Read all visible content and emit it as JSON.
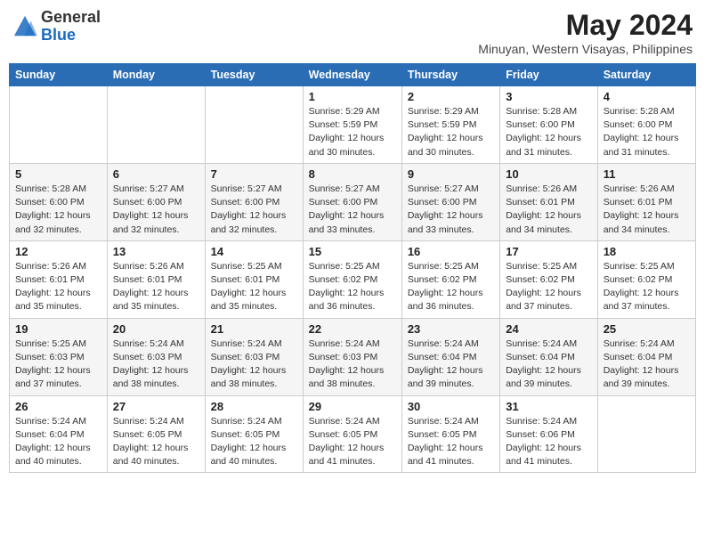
{
  "header": {
    "logo_general": "General",
    "logo_blue": "Blue",
    "month_year": "May 2024",
    "location": "Minuyan, Western Visayas, Philippines"
  },
  "days_of_week": [
    "Sunday",
    "Monday",
    "Tuesday",
    "Wednesday",
    "Thursday",
    "Friday",
    "Saturday"
  ],
  "weeks": [
    [
      {
        "num": "",
        "info": ""
      },
      {
        "num": "",
        "info": ""
      },
      {
        "num": "",
        "info": ""
      },
      {
        "num": "1",
        "info": "Sunrise: 5:29 AM\nSunset: 5:59 PM\nDaylight: 12 hours\nand 30 minutes."
      },
      {
        "num": "2",
        "info": "Sunrise: 5:29 AM\nSunset: 5:59 PM\nDaylight: 12 hours\nand 30 minutes."
      },
      {
        "num": "3",
        "info": "Sunrise: 5:28 AM\nSunset: 6:00 PM\nDaylight: 12 hours\nand 31 minutes."
      },
      {
        "num": "4",
        "info": "Sunrise: 5:28 AM\nSunset: 6:00 PM\nDaylight: 12 hours\nand 31 minutes."
      }
    ],
    [
      {
        "num": "5",
        "info": "Sunrise: 5:28 AM\nSunset: 6:00 PM\nDaylight: 12 hours\nand 32 minutes."
      },
      {
        "num": "6",
        "info": "Sunrise: 5:27 AM\nSunset: 6:00 PM\nDaylight: 12 hours\nand 32 minutes."
      },
      {
        "num": "7",
        "info": "Sunrise: 5:27 AM\nSunset: 6:00 PM\nDaylight: 12 hours\nand 32 minutes."
      },
      {
        "num": "8",
        "info": "Sunrise: 5:27 AM\nSunset: 6:00 PM\nDaylight: 12 hours\nand 33 minutes."
      },
      {
        "num": "9",
        "info": "Sunrise: 5:27 AM\nSunset: 6:00 PM\nDaylight: 12 hours\nand 33 minutes."
      },
      {
        "num": "10",
        "info": "Sunrise: 5:26 AM\nSunset: 6:01 PM\nDaylight: 12 hours\nand 34 minutes."
      },
      {
        "num": "11",
        "info": "Sunrise: 5:26 AM\nSunset: 6:01 PM\nDaylight: 12 hours\nand 34 minutes."
      }
    ],
    [
      {
        "num": "12",
        "info": "Sunrise: 5:26 AM\nSunset: 6:01 PM\nDaylight: 12 hours\nand 35 minutes."
      },
      {
        "num": "13",
        "info": "Sunrise: 5:26 AM\nSunset: 6:01 PM\nDaylight: 12 hours\nand 35 minutes."
      },
      {
        "num": "14",
        "info": "Sunrise: 5:25 AM\nSunset: 6:01 PM\nDaylight: 12 hours\nand 35 minutes."
      },
      {
        "num": "15",
        "info": "Sunrise: 5:25 AM\nSunset: 6:02 PM\nDaylight: 12 hours\nand 36 minutes."
      },
      {
        "num": "16",
        "info": "Sunrise: 5:25 AM\nSunset: 6:02 PM\nDaylight: 12 hours\nand 36 minutes."
      },
      {
        "num": "17",
        "info": "Sunrise: 5:25 AM\nSunset: 6:02 PM\nDaylight: 12 hours\nand 37 minutes."
      },
      {
        "num": "18",
        "info": "Sunrise: 5:25 AM\nSunset: 6:02 PM\nDaylight: 12 hours\nand 37 minutes."
      }
    ],
    [
      {
        "num": "19",
        "info": "Sunrise: 5:25 AM\nSunset: 6:03 PM\nDaylight: 12 hours\nand 37 minutes."
      },
      {
        "num": "20",
        "info": "Sunrise: 5:24 AM\nSunset: 6:03 PM\nDaylight: 12 hours\nand 38 minutes."
      },
      {
        "num": "21",
        "info": "Sunrise: 5:24 AM\nSunset: 6:03 PM\nDaylight: 12 hours\nand 38 minutes."
      },
      {
        "num": "22",
        "info": "Sunrise: 5:24 AM\nSunset: 6:03 PM\nDaylight: 12 hours\nand 38 minutes."
      },
      {
        "num": "23",
        "info": "Sunrise: 5:24 AM\nSunset: 6:04 PM\nDaylight: 12 hours\nand 39 minutes."
      },
      {
        "num": "24",
        "info": "Sunrise: 5:24 AM\nSunset: 6:04 PM\nDaylight: 12 hours\nand 39 minutes."
      },
      {
        "num": "25",
        "info": "Sunrise: 5:24 AM\nSunset: 6:04 PM\nDaylight: 12 hours\nand 39 minutes."
      }
    ],
    [
      {
        "num": "26",
        "info": "Sunrise: 5:24 AM\nSunset: 6:04 PM\nDaylight: 12 hours\nand 40 minutes."
      },
      {
        "num": "27",
        "info": "Sunrise: 5:24 AM\nSunset: 6:05 PM\nDaylight: 12 hours\nand 40 minutes."
      },
      {
        "num": "28",
        "info": "Sunrise: 5:24 AM\nSunset: 6:05 PM\nDaylight: 12 hours\nand 40 minutes."
      },
      {
        "num": "29",
        "info": "Sunrise: 5:24 AM\nSunset: 6:05 PM\nDaylight: 12 hours\nand 41 minutes."
      },
      {
        "num": "30",
        "info": "Sunrise: 5:24 AM\nSunset: 6:05 PM\nDaylight: 12 hours\nand 41 minutes."
      },
      {
        "num": "31",
        "info": "Sunrise: 5:24 AM\nSunset: 6:06 PM\nDaylight: 12 hours\nand 41 minutes."
      },
      {
        "num": "",
        "info": ""
      }
    ]
  ]
}
